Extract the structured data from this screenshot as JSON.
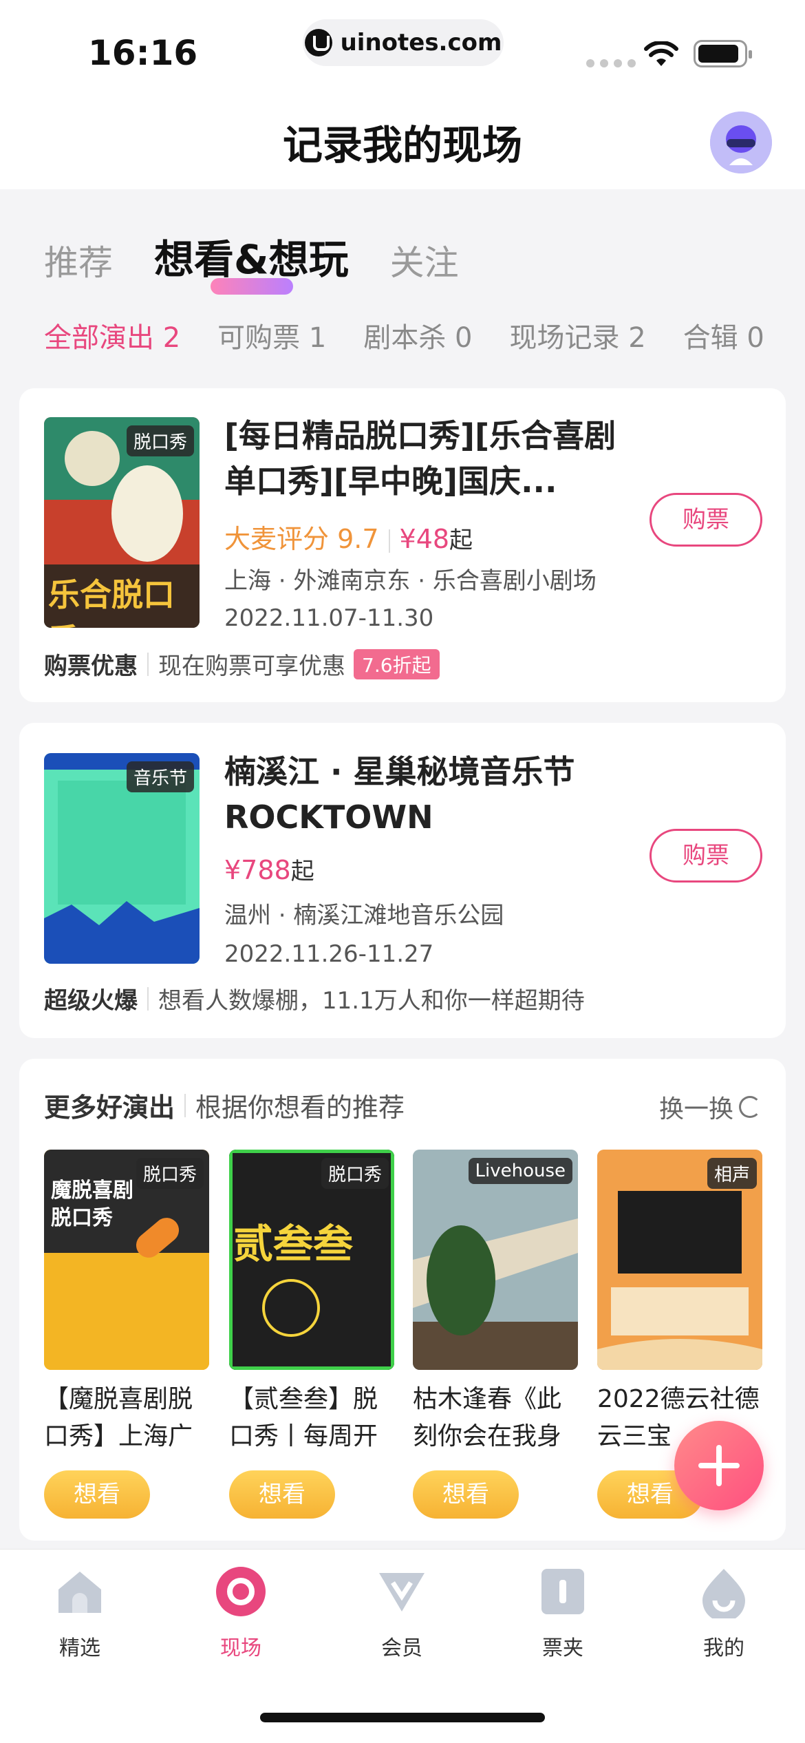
{
  "status": {
    "time": "16:16",
    "url": "uinotes.com"
  },
  "header": {
    "title": "记录我的现场"
  },
  "main_tabs": [
    {
      "label": "推荐"
    },
    {
      "label": "想看&想玩"
    },
    {
      "label": "关注"
    }
  ],
  "sub_tabs": [
    {
      "label": "全部演出 2"
    },
    {
      "label": "可购票 1"
    },
    {
      "label": "剧本杀 0"
    },
    {
      "label": "现场记录 2"
    },
    {
      "label": "合辑 0"
    }
  ],
  "shows": [
    {
      "tag": "脱口秀",
      "poster_text": "乐合脱口秀",
      "title": "[每日精品脱口秀][乐合喜剧单口秀][早中晚]国庆...",
      "rating": "大麦评分 9.7",
      "price": "¥48",
      "price_suffix": "起",
      "venue": "上海 · 外滩南京东 · 乐合喜剧小剧场",
      "date": "2022.11.07-11.30",
      "buy_label": "购票",
      "foot_label": "购票优惠",
      "foot_text": "现在购票可享优惠",
      "discount": "7.6折起"
    },
    {
      "tag": "音乐节",
      "title": "楠溪江 · 星巢秘境音乐节 ROCKTOWN",
      "price": "¥788",
      "price_suffix": "起",
      "venue": "温州 · 楠溪江滩地音乐公园",
      "date": "2022.11.26-11.27",
      "buy_label": "购票",
      "foot_label": "超级火爆",
      "foot_text": "想看人数爆棚，11.1万人和你一样超期待"
    }
  ],
  "recommend": {
    "title": "更多好演出",
    "subtitle": "根据你想看的推荐",
    "refresh": "换一换",
    "items": [
      {
        "tag": "脱口秀",
        "poster_text": "魔脱喜剧脱口秀",
        "title": "【魔脱喜剧脱口秀】上海广",
        "want": "想看"
      },
      {
        "tag": "脱口秀",
        "poster_text": "贰叁叁",
        "title": "【贰叁叁】脱口秀丨每周开",
        "want": "想看"
      },
      {
        "tag": "Livehouse",
        "title": "枯木逢春《此刻你会在我身",
        "want": "想看"
      },
      {
        "tag": "相声",
        "title": "2022德云社德云三宝",
        "want": "想看"
      }
    ]
  },
  "tabbar": [
    {
      "label": "精选"
    },
    {
      "label": "现场"
    },
    {
      "label": "会员"
    },
    {
      "label": "票夹"
    },
    {
      "label": "我的"
    }
  ],
  "colors": {
    "accent": "#e8477e",
    "rating": "#f0943a",
    "want": "#f6b233"
  }
}
